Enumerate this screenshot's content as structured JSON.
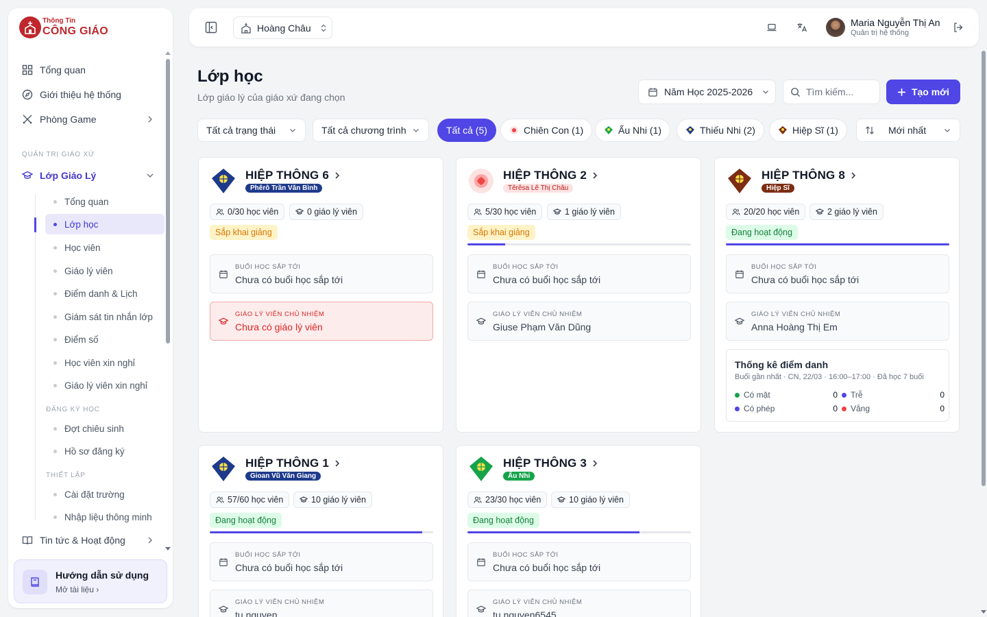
{
  "brand": {
    "line1": "Thông Tin",
    "line2": "CÔNG GIÁO"
  },
  "sidebar": {
    "top_items": [
      {
        "label": "Tổng quan"
      },
      {
        "label": "Giới thiệu hệ thống"
      },
      {
        "label": "Phòng Game"
      }
    ],
    "section_label": "QUẢN TRỊ GIÁO XỨ",
    "group": {
      "label": "Lớp Giáo Lý"
    },
    "subs": [
      {
        "label": "Tổng quan"
      },
      {
        "label": "Lớp học"
      },
      {
        "label": "Học viên"
      },
      {
        "label": "Giáo lý viên"
      },
      {
        "label": "Điểm danh & Lịch"
      },
      {
        "label": "Giám sát tin nhắn lớp"
      },
      {
        "label": "Điểm số"
      },
      {
        "label": "Học viên xin nghỉ"
      },
      {
        "label": "Giáo lý viên xin nghỉ"
      }
    ],
    "subsection_reg": "ĐĂNG KÝ HỌC",
    "reg_items": [
      {
        "label": "Đợt chiêu sinh"
      },
      {
        "label": "Hồ sơ đăng ký"
      }
    ],
    "subsection_setup": "THIẾT LẬP",
    "setup_items": [
      {
        "label": "Cài đặt trường"
      },
      {
        "label": "Nhập liệu thông minh"
      }
    ],
    "news": {
      "label": "Tin tức & Hoạt động"
    },
    "guide": {
      "title": "Hướng dẫn sử dụng",
      "link": "Mở tài liệu"
    }
  },
  "header": {
    "parish": "Hoàng Châu",
    "user_name": "Maria Nguyễn Thị An",
    "user_role": "Quản trị hệ thống"
  },
  "page": {
    "title": "Lớp học",
    "subtitle": "Lớp giáo lý của giáo xứ đang chọn",
    "year_select": "Năm Học 2025-2026",
    "search_placeholder": "Tìm kiếm...",
    "new_button": "Tạo mới"
  },
  "filters": {
    "status": "Tất cả trạng thái",
    "program": "Tất cả chương trình",
    "sort": "Mới nhất",
    "pills": [
      {
        "label": "Tất cả (5)",
        "active": true
      },
      {
        "label": "Chiên Con (1)",
        "color": "#ef4444"
      },
      {
        "label": "Ấu Nhi (1)",
        "color": "#16a34a"
      },
      {
        "label": "Thiếu Nhi (2)",
        "color": "#1e3a8a"
      },
      {
        "label": "Hiệp Sĩ (1)",
        "color": "#7c2d12"
      }
    ]
  },
  "cards": [
    {
      "name": "HIỆP THÔNG 6",
      "tag": "Phêrô Trần Văn Bình",
      "tag_color": "#1e3a8a",
      "badge_color": "#1e3a8a",
      "students": "0/30 học viên",
      "teachers": "0 giáo lý viên",
      "status": "Sắp khai giảng",
      "status_type": "pending",
      "progress": 0,
      "next_label": "BUỔI HỌC SẮP TỚI",
      "next_value": "Chưa có buổi học sắp tới",
      "homeroom_label": "GIÁO LÝ VIÊN CHỦ NHIỆM",
      "homeroom_value": "Chưa có giáo lý viên",
      "homeroom_missing": true
    },
    {
      "name": "HIỆP THÔNG 2",
      "tag": "Têrêsa Lê Thị Châu",
      "tag_color": "#fde2e2",
      "tag_text_color": "#b91c1c",
      "badge_color": "#ef4444",
      "students": "5/30 học viên",
      "teachers": "1 giáo lý viên",
      "status": "Sắp khai giảng",
      "status_type": "pending",
      "progress": 0.17,
      "next_label": "BUỔI HỌC SẮP TỚI",
      "next_value": "Chưa có buổi học sắp tới",
      "homeroom_label": "GIÁO LÝ VIÊN CHỦ NHIỆM",
      "homeroom_value": "Giuse Phạm Văn Dũng"
    },
    {
      "name": "HIỆP THÔNG 8",
      "tag": "Hiệp Sĩ",
      "tag_color": "#7c2d12",
      "badge_color": "#7c2d12",
      "students": "20/20 học viên",
      "teachers": "2 giáo lý viên",
      "status": "Đang hoạt động",
      "status_type": "active",
      "progress": 1.0,
      "next_label": "BUỔI HỌC SẮP TỚI",
      "next_value": "Chưa có buổi học sắp tới",
      "homeroom_label": "GIÁO LÝ VIÊN CHỦ NHIỆM",
      "homeroom_value": "Anna Hoàng Thị Em",
      "attendance": {
        "title": "Thống kê điểm danh",
        "subtitle": "Buổi gần nhất · CN, 22/03 · 16:00–17:00 · Đã học 7 buổi",
        "rows": [
          {
            "label": "Có mặt",
            "value": "0",
            "color": "#16a34a"
          },
          {
            "label": "Trễ",
            "value": "0",
            "color": "#4f46e5"
          },
          {
            "label": "Có phép",
            "value": "0",
            "color": "#4f46e5"
          },
          {
            "label": "Vắng",
            "value": "0",
            "color": "#ef4444"
          }
        ]
      }
    },
    {
      "name": "HIỆP THÔNG 1",
      "tag": "Gioan Vũ Văn Giang",
      "tag_color": "#1e3a8a",
      "badge_color": "#1e3a8a",
      "students": "57/60 học viên",
      "teachers": "10 giáo lý viên",
      "status": "Đang hoạt động",
      "status_type": "active",
      "progress": 0.95,
      "next_label": "BUỔI HỌC SẮP TỚI",
      "next_value": "Chưa có buổi học sắp tới",
      "homeroom_label": "GIÁO LÝ VIÊN CHỦ NHIỆM",
      "homeroom_value": "tu nguyen"
    },
    {
      "name": "HIỆP THÔNG 3",
      "tag": "Ấu Nhi",
      "tag_color": "#16a34a",
      "badge_color": "#16a34a",
      "students": "23/30 học viên",
      "teachers": "10 giáo lý viên",
      "status": "Đang hoạt động",
      "status_type": "active",
      "progress": 0.77,
      "next_label": "BUỔI HỌC SẮP TỚI",
      "next_value": "Chưa có buổi học sắp tới",
      "homeroom_label": "GIÁO LÝ VIÊN CHỦ NHIỆM",
      "homeroom_value": "tu nguyen6545"
    }
  ]
}
